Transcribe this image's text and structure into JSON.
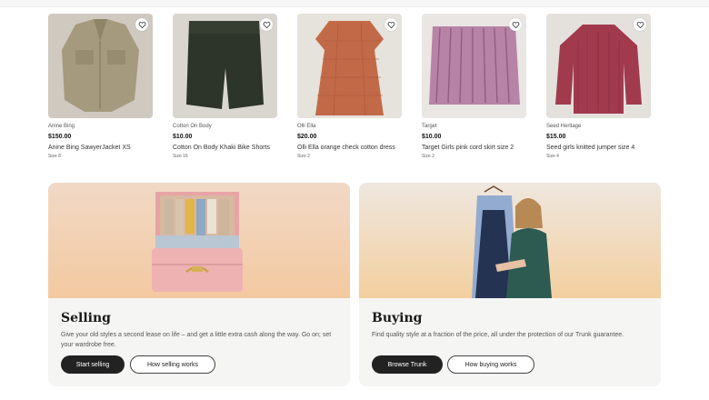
{
  "products": [
    {
      "brand": "Anine Bing",
      "price": "$150.00",
      "title": "Anine Bing SawyerJacket XS",
      "size": "Size 8",
      "image_icon": "khaki-jacket"
    },
    {
      "brand": "Cotton On Body",
      "price": "$10.00",
      "title": "Cotton On Body Khaki Bike Shorts",
      "size": "Size 16",
      "image_icon": "green-shorts"
    },
    {
      "brand": "Olli Ella",
      "price": "$20.00",
      "title": "Olli Ella orange check cotton dress",
      "size": "Size 2",
      "image_icon": "orange-dress"
    },
    {
      "brand": "Target",
      "price": "$10.00",
      "title": "Target Girls pink cord skirt size 2",
      "size": "Size 2",
      "image_icon": "pink-skirt"
    },
    {
      "brand": "Seed Heritage",
      "price": "$15.00",
      "title": "Seed girls knitted jumper size 4",
      "size": "Size 4",
      "image_icon": "red-jumper"
    }
  ],
  "selling": {
    "heading": "Selling",
    "text": "Give your old styles a second lease on life – and get a little extra cash along the way. Go on; set your wardrobe free.",
    "primary_button": "Start selling",
    "secondary_button": "How selling works"
  },
  "buying": {
    "heading": "Buying",
    "text": "Find quality style at a fraction of the price, all under the protection of our Trunk guarantee.",
    "primary_button": "Browse Trunk",
    "secondary_button": "How buying works"
  },
  "colors": {
    "button_dark": "#222222",
    "card_bg": "#f5f5f4",
    "banner_warm": "#f3c9a8"
  }
}
